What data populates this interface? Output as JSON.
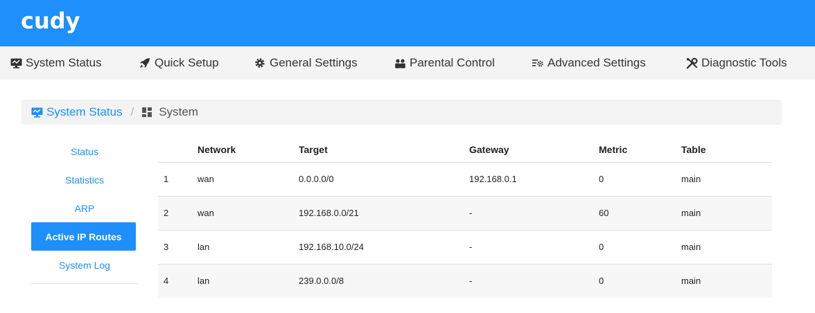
{
  "brand": {
    "logo": "cudy"
  },
  "nav": [
    {
      "label": "System Status",
      "icon": "monitor-icon"
    },
    {
      "label": "Quick Setup",
      "icon": "rocket-icon"
    },
    {
      "label": "General Settings",
      "icon": "gear-icon"
    },
    {
      "label": "Parental Control",
      "icon": "users-icon"
    },
    {
      "label": "Advanced Settings",
      "icon": "advanced-settings-icon"
    },
    {
      "label": "Diagnostic Tools",
      "icon": "tools-icon"
    }
  ],
  "breadcrumb": {
    "parent": "System Status",
    "separator": "/",
    "current": "System"
  },
  "sidebar": {
    "items": [
      {
        "label": "Status"
      },
      {
        "label": "Statistics"
      },
      {
        "label": "ARP"
      },
      {
        "label": "Active IP Routes",
        "active": true
      },
      {
        "label": "System Log"
      }
    ]
  },
  "routes": {
    "columns": [
      "",
      "Network",
      "Target",
      "Gateway",
      "Metric",
      "Table"
    ],
    "rows": [
      {
        "index": "1",
        "network": "wan",
        "target": "0.0.0.0/0",
        "gateway": "192.168.0.1",
        "metric": "0",
        "table": "main"
      },
      {
        "index": "2",
        "network": "wan",
        "target": "192.168.0.0/21",
        "gateway": "-",
        "metric": "60",
        "table": "main"
      },
      {
        "index": "3",
        "network": "lan",
        "target": "192.168.10.0/24",
        "gateway": "-",
        "metric": "0",
        "table": "main"
      },
      {
        "index": "4",
        "network": "lan",
        "target": "239.0.0.0/8",
        "gateway": "-",
        "metric": "0",
        "table": "main"
      }
    ]
  },
  "colors": {
    "accent": "#1e8ffb",
    "nav_bg": "#f4f4f4",
    "row_alt": "#f7f7f7"
  }
}
